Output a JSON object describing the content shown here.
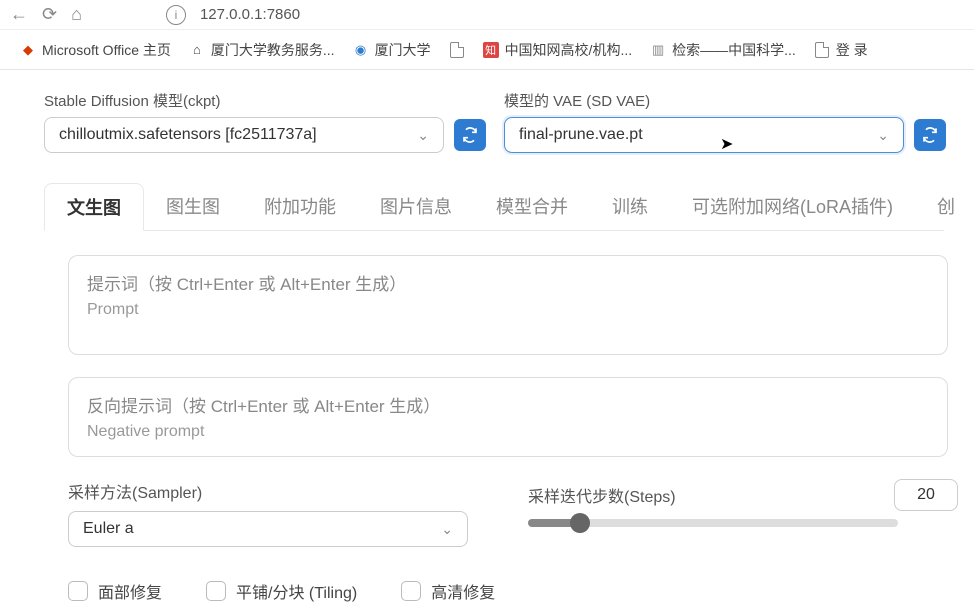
{
  "address": {
    "url": "127.0.0.1:7860"
  },
  "bookmarks": [
    {
      "label": "Microsoft Office 主页",
      "icon": "ms"
    },
    {
      "label": "厦门大学教务服务...",
      "icon": "home"
    },
    {
      "label": "厦门大学",
      "icon": "globe"
    },
    {
      "label": "",
      "icon": "file"
    },
    {
      "label": "中国知网高校/机构...",
      "icon": "zhi"
    },
    {
      "label": "检索——中国科学...",
      "icon": "bar"
    },
    {
      "label": "登 录",
      "icon": "file"
    }
  ],
  "selectors": {
    "ckpt_label": "Stable Diffusion 模型(ckpt)",
    "ckpt_value": "chilloutmix.safetensors [fc2511737a]",
    "vae_label": "模型的 VAE (SD VAE)",
    "vae_value": "final-prune.vae.pt"
  },
  "tabs": [
    "文生图",
    "图生图",
    "附加功能",
    "图片信息",
    "模型合并",
    "训练",
    "可选附加网络(LoRA插件)",
    "创"
  ],
  "active_tab": 0,
  "prompt": {
    "line1": "提示词（按 Ctrl+Enter 或 Alt+Enter 生成）",
    "line2": "Prompt"
  },
  "neg_prompt": {
    "line1": "反向提示词（按 Ctrl+Enter 或 Alt+Enter 生成）",
    "line2": "Negative prompt"
  },
  "sampler": {
    "label": "采样方法(Sampler)",
    "value": "Euler a"
  },
  "steps": {
    "label": "采样迭代步数(Steps)",
    "value": "20"
  },
  "checkboxes": {
    "face": "面部修复",
    "tiling": "平铺/分块 (Tiling)",
    "hires": "高清修复"
  }
}
